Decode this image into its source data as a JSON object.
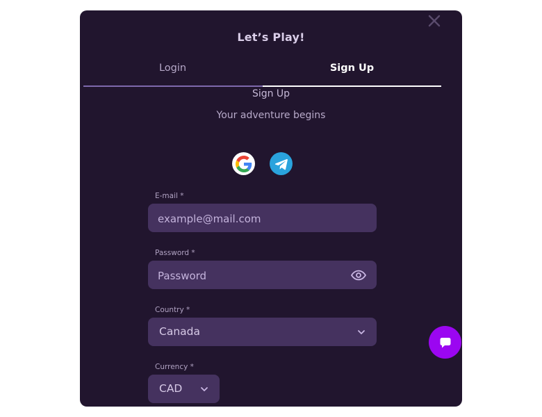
{
  "modal": {
    "title": "Let’s Play!",
    "close_icon": "close-icon"
  },
  "tabs": [
    {
      "label": "Login",
      "active": false
    },
    {
      "label": "Sign Up",
      "active": true
    }
  ],
  "signup": {
    "heading": "Sign Up",
    "subheading": "Your adventure begins"
  },
  "social": [
    {
      "name": "google-icon"
    },
    {
      "name": "telegram-icon"
    }
  ],
  "form": {
    "email": {
      "label": "E-mail *",
      "placeholder": "example@mail.com",
      "value": ""
    },
    "password": {
      "label": "Password *",
      "placeholder": "Password",
      "value": "",
      "icon": "eye-icon"
    },
    "country": {
      "label": "Country *",
      "value": "Canada",
      "icon": "chevron-down-icon"
    },
    "currency": {
      "label": "Currency *",
      "value": "CAD",
      "icon": "chevron-down-icon"
    }
  },
  "chat": {
    "icon": "chat-bubble-icon"
  },
  "colors": {
    "modal_bg": "#21152e",
    "field_bg": "#45325f",
    "accent": "#9b06f1",
    "telegram": "#2aa3dd"
  }
}
